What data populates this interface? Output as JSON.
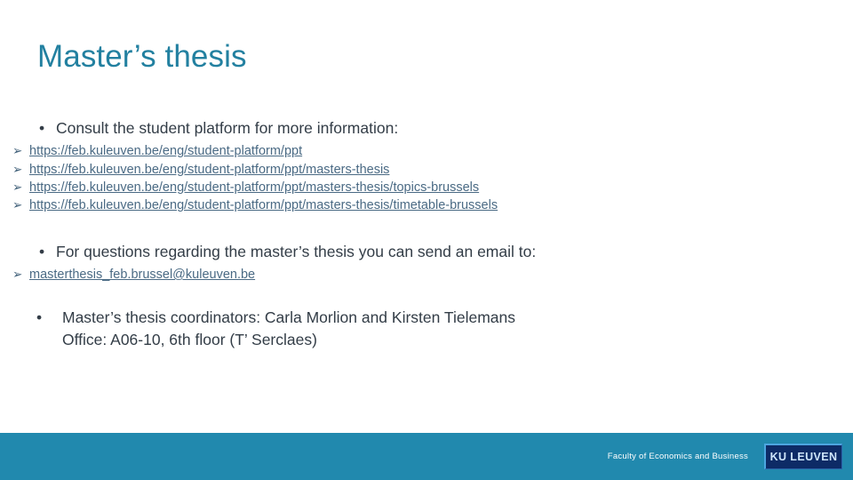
{
  "slide": {
    "title": "Master’s thesis",
    "title_color": "#2280a0",
    "body_color": "#333d47",
    "link_color": "#4a6a84",
    "accent_color": "#2189ae"
  },
  "bullets": [
    {
      "marker": "•",
      "text": "Consult the student platform for more information:",
      "sub_marker": "➢",
      "sub_items": [
        "https://feb.kuleuven.be/eng/student-platform/ppt",
        "https://feb.kuleuven.be/eng/student-platform/ppt/masters-thesis",
        "https://feb.kuleuven.be/eng/student-platform/ppt/masters-thesis/topics-brussels",
        "https://feb.kuleuven.be/eng/student-platform/ppt/masters-thesis/timetable-brussels"
      ]
    },
    {
      "marker": "•",
      "text": "For questions regarding the master’s thesis you can send an email to:",
      "sub_marker": "➢",
      "sub_items": [
        "masterthesis_feb.brussel@kuleuven.be"
      ]
    },
    {
      "marker": "•",
      "text": " Master’s thesis coordinators: Carla Morlion and Kirsten Tielemans",
      "second_line": "Office: A06-10, 6th floor (T’ Serclaes)"
    }
  ],
  "footer": {
    "faculty_text": "Faculty of Economics and Business",
    "logo_text": "KU LEUVEN",
    "logo_bg": "#0d2b66",
    "logo_text_color": "#cfe6fb"
  }
}
